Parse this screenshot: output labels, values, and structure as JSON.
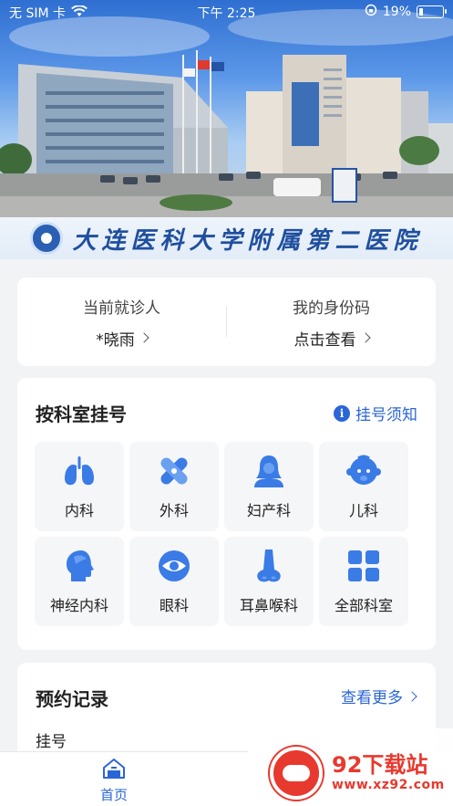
{
  "status_bar": {
    "carrier": "无 SIM 卡",
    "time": "下午 2:25",
    "battery": "19%",
    "battery_level": 0.19
  },
  "hospital": {
    "name": "大连医科大学附属第二医院"
  },
  "patient": {
    "current_label": "当前就诊人",
    "current_value": "*晓雨",
    "id_label": "我的身份码",
    "id_value": "点击查看"
  },
  "departments": {
    "title": "按科室挂号",
    "notice_label": "挂号须知",
    "items": [
      {
        "label": "内科",
        "icon": "lungs-icon"
      },
      {
        "label": "外科",
        "icon": "bandage-icon"
      },
      {
        "label": "妇产科",
        "icon": "woman-icon"
      },
      {
        "label": "儿科",
        "icon": "baby-icon"
      },
      {
        "label": "神经内科",
        "icon": "head-brain-icon"
      },
      {
        "label": "眼科",
        "icon": "eye-icon"
      },
      {
        "label": "耳鼻喉科",
        "icon": "nose-icon"
      },
      {
        "label": "全部科室",
        "icon": "grid-icon"
      }
    ]
  },
  "records": {
    "title": "预约记录",
    "more_label": "查看更多",
    "first_item": "挂号"
  },
  "tabbar": {
    "home_label": "首页"
  },
  "watermark": {
    "name": "92下载站",
    "url": "www.xz92.com"
  },
  "colors": {
    "accent": "#2a66d6",
    "background": "#f2f3f5",
    "icon_blue": "#3a7be6"
  }
}
